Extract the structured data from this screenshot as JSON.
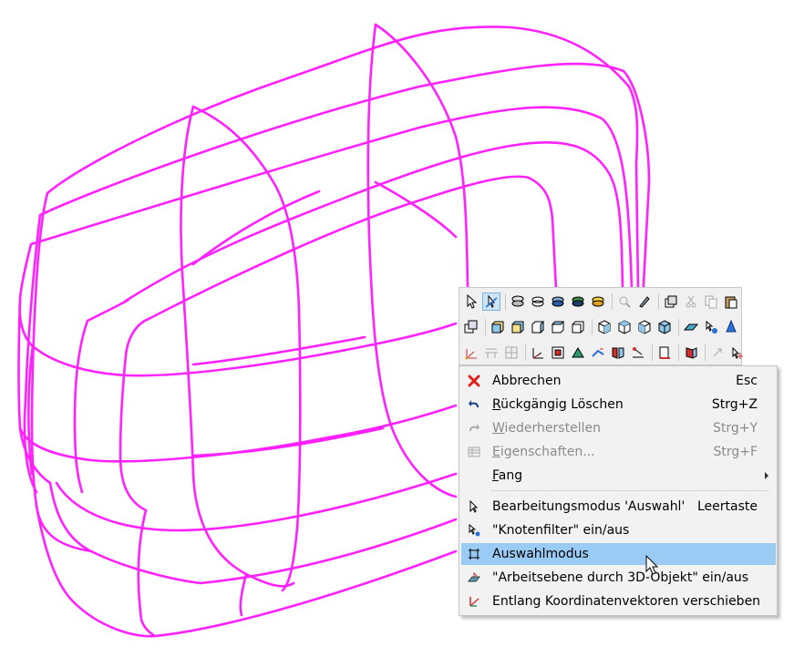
{
  "colors": {
    "wire": "#ff22ff",
    "menu_bg": "#f2f2f2",
    "highlight": "#99cbf5",
    "disabled_text": "#8a8a8a",
    "delete_red": "#e0201b"
  },
  "toolbar": {
    "row1": [
      "select-arrow-icon",
      "select-node-icon",
      "layer-icon",
      "layer-outline-icon",
      "layer-fill-icon",
      "layer-dark-icon",
      "layer-yellow-icon",
      "zoom-icon",
      "pick-icon",
      "copy-layers-icon",
      "cut-icon",
      "copy-icon",
      "paste-icon"
    ],
    "row2": [
      "window-copy-icon",
      "cube-front-icon",
      "cube-back-icon",
      "cube-left-icon",
      "cube-right-icon",
      "cube-top-icon",
      "cube-iso1-icon",
      "cube-iso2-icon",
      "cube-iso3-icon",
      "cube-iso4-icon",
      "workplane-icon",
      "move-node-icon",
      "cone-icon"
    ],
    "row3": [
      "axis-icon",
      "plane-icon",
      "grid-icon",
      "coord-icon",
      "frame-icon",
      "triangle-icon",
      "vector-icon",
      "mirror-icon",
      "transform-icon",
      "book-icon",
      "prism-icon",
      "arrow-up-icon",
      "move-icon"
    ]
  },
  "menu": {
    "items": [
      {
        "label": "Abbrechen",
        "shortcut": "Esc",
        "icon": "cancel-icon",
        "enabled": true
      },
      {
        "label_pre": "",
        "label_u": "R",
        "label_post": "ückgängig Löschen",
        "shortcut": "Strg+Z",
        "icon": "undo-icon",
        "enabled": true
      },
      {
        "label_pre": "",
        "label_u": "W",
        "label_post": "iederherstellen",
        "shortcut": "Strg+Y",
        "icon": "redo-icon",
        "enabled": false
      },
      {
        "label_pre": "",
        "label_u": "E",
        "label_post": "igenschaften...",
        "shortcut": "Strg+F",
        "icon": "properties-icon",
        "enabled": false
      },
      {
        "label_pre": "",
        "label_u": "F",
        "label_post": "ang",
        "shortcut": "",
        "icon": "",
        "enabled": true,
        "submenu": true
      },
      {
        "label": "Bearbeitungsmodus 'Auswahl'",
        "shortcut": "Leertaste",
        "icon": "arrow-cursor-icon",
        "enabled": true
      },
      {
        "label": "\"Knotenfilter\" ein/aus",
        "shortcut": "",
        "icon": "node-filter-icon",
        "enabled": true
      },
      {
        "label": "Auswahlmodus",
        "shortcut": "",
        "icon": "selection-mode-icon",
        "enabled": true,
        "highlighted": true
      },
      {
        "label": "\"Arbeitsebene durch 3D-Objekt\" ein/aus",
        "shortcut": "",
        "icon": "workplane-3d-icon",
        "enabled": true
      },
      {
        "label": "Entlang Koordinatenvektoren verschieben",
        "shortcut": "",
        "icon": "coord-vectors-icon",
        "enabled": true
      }
    ]
  }
}
